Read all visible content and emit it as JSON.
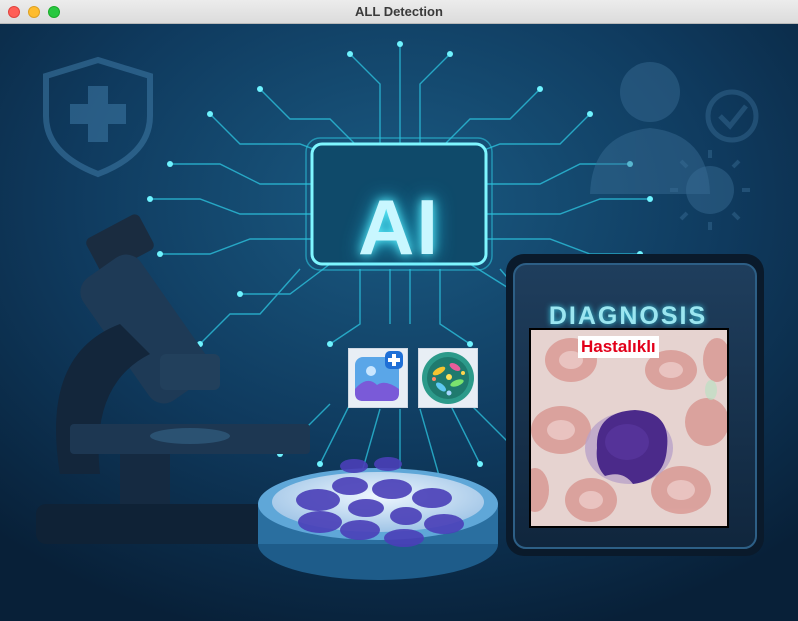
{
  "window": {
    "title": "ALL Detection"
  },
  "hero": {
    "ai_label": "AI"
  },
  "diagnosis": {
    "title": "DIAGNOSIS",
    "result": "Hastalıklı"
  },
  "icons": {
    "upload": "image-add-icon",
    "analyze": "bacteria-icon",
    "shield": "shield-plus-icon",
    "doctor": "doctor-icon",
    "virus": "virus-icon",
    "microscope": "microscope-icon"
  },
  "colors": {
    "accent": "#5ff3ff",
    "result": "#e2001a",
    "background": "#0b2a47"
  }
}
